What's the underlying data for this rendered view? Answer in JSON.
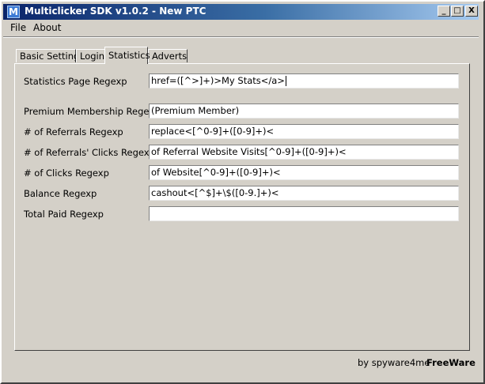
{
  "window": {
    "title": "Multiclicker SDK v1.0.2 - New PTC",
    "icon_letter": "M",
    "minimize_glyph": "_",
    "maximize_glyph": "□",
    "close_glyph": "X"
  },
  "menu": {
    "items": [
      "File",
      "About"
    ]
  },
  "tabs": [
    {
      "label": "Basic Settings",
      "active": false
    },
    {
      "label": "Login",
      "active": false
    },
    {
      "label": "Statistics",
      "active": true
    },
    {
      "label": "Adverts",
      "active": false
    }
  ],
  "fields": [
    {
      "label": "Statistics Page Regexp",
      "value": "href=([^>]+)>My Stats</a>"
    },
    {
      "label": "Premium Membership Regexp",
      "value": "(Premium Member)"
    },
    {
      "label": "# of Referrals Regexp",
      "value": "replace<[^0-9]+([0-9]+)<"
    },
    {
      "label": "# of Referrals' Clicks Regexp",
      "value": "of Referral Website Visits[^0-9]+([0-9]+)<"
    },
    {
      "label": "# of Clicks Regexp",
      "value": "of Website[^0-9]+([0-9]+)<"
    },
    {
      "label": "Balance Regexp",
      "value": "cashout<[^$]+\\$([0-9.]+)<"
    },
    {
      "label": "Total Paid Regexp",
      "value": ""
    }
  ],
  "footer": {
    "author": "by spyware4me",
    "license": "FreeWare"
  },
  "colors": {
    "window_bg": "#d4d0c8",
    "title_start": "#0a246a",
    "title_end": "#a6caf0",
    "field_bg": "#ffffff"
  }
}
